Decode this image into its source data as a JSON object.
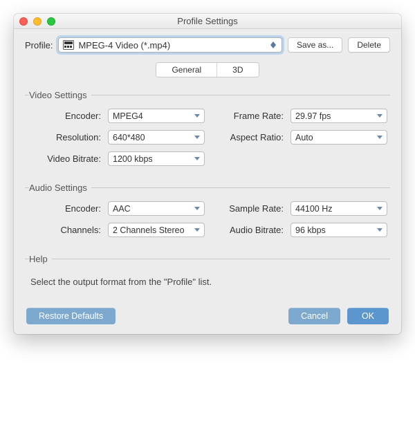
{
  "window": {
    "title": "Profile Settings"
  },
  "profile": {
    "label": "Profile:",
    "selected": "MPEG-4 Video (*.mp4)",
    "save_as": "Save as...",
    "delete": "Delete"
  },
  "tabs": {
    "general": "General",
    "three_d": "3D",
    "active": "general"
  },
  "video": {
    "legend": "Video Settings",
    "encoder_label": "Encoder:",
    "encoder": "MPEG4",
    "frame_rate_label": "Frame Rate:",
    "frame_rate": "29.97 fps",
    "resolution_label": "Resolution:",
    "resolution": "640*480",
    "aspect_ratio_label": "Aspect Ratio:",
    "aspect_ratio": "Auto",
    "video_bitrate_label": "Video Bitrate:",
    "video_bitrate": "1200 kbps"
  },
  "audio": {
    "legend": "Audio Settings",
    "encoder_label": "Encoder:",
    "encoder": "AAC",
    "sample_rate_label": "Sample Rate:",
    "sample_rate": "44100 Hz",
    "channels_label": "Channels:",
    "channels": "2 Channels Stereo",
    "audio_bitrate_label": "Audio Bitrate:",
    "audio_bitrate": "96 kbps"
  },
  "help": {
    "legend": "Help",
    "text": "Select the output format from the \"Profile\" list."
  },
  "footer": {
    "restore": "Restore Defaults",
    "cancel": "Cancel",
    "ok": "OK"
  }
}
